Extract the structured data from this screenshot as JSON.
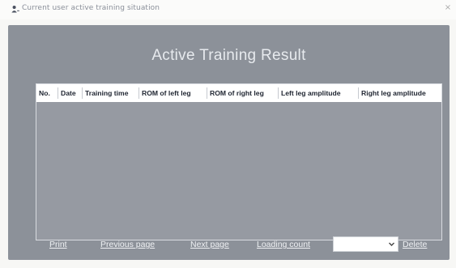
{
  "window": {
    "title": "Current user active training situation",
    "title_icon": "user-icon",
    "close_icon": "close-icon",
    "close_glyph": "×"
  },
  "panel": {
    "heading": "Active Training Result"
  },
  "table": {
    "columns": [
      "No.",
      "Date",
      "Training time",
      "ROM of  left leg",
      "ROM of  right leg",
      "Left leg amplitude",
      "Right leg amplitude"
    ],
    "rows": []
  },
  "footer": {
    "print": "Print",
    "previous_page": "Previous page",
    "next_page": "Next page",
    "loading_count": "Loading count",
    "select_value": "",
    "delete": "Delete"
  },
  "colors": {
    "panel": "#8c9199",
    "link": "#eef0f3",
    "heading": "#e7eaee"
  }
}
